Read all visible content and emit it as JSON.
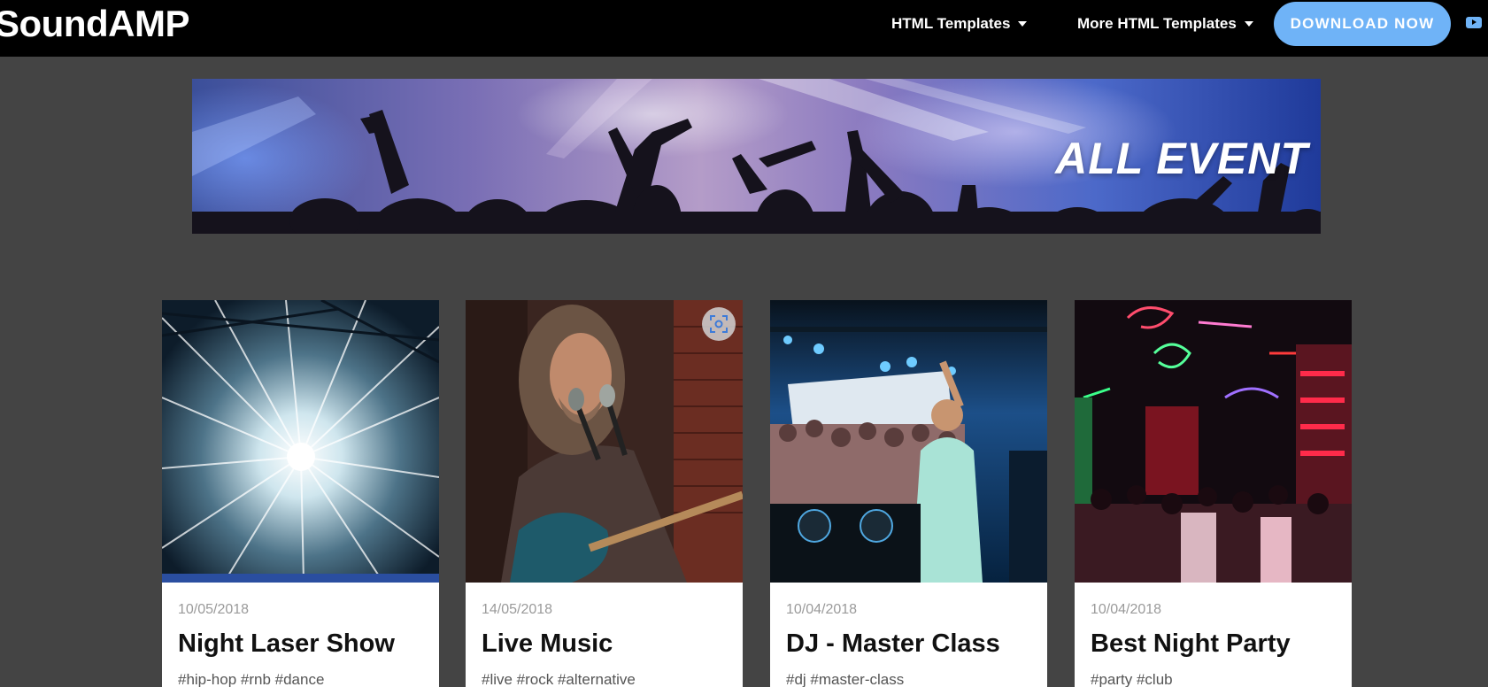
{
  "header": {
    "logo": "SoundAMP",
    "nav": [
      {
        "label": "HTML Templates"
      },
      {
        "label": "More HTML Templates"
      }
    ],
    "download_label": "DOWNLOAD NOW",
    "accent_color": "#6fb3f7"
  },
  "banner": {
    "title": "ALL EVENT"
  },
  "events": [
    {
      "date": "10/05/2018",
      "title": "Night Laser Show",
      "tags": "#hip-hop #rnb #dance",
      "image": "laser-light-photo"
    },
    {
      "date": "14/05/2018",
      "title": "Live Music",
      "tags": "#live #rock #alternative",
      "image": "singer-guitarist-photo"
    },
    {
      "date": "10/04/2018",
      "title": "DJ - Master Class",
      "tags": "#dj #master-class",
      "image": "dj-crowd-photo"
    },
    {
      "date": "10/04/2018",
      "title": "Best Night Party",
      "tags": "#party #club",
      "image": "neon-street-photo"
    }
  ],
  "icons": [
    "caret-down-icon",
    "youtube-icon",
    "visual-search-icon"
  ]
}
